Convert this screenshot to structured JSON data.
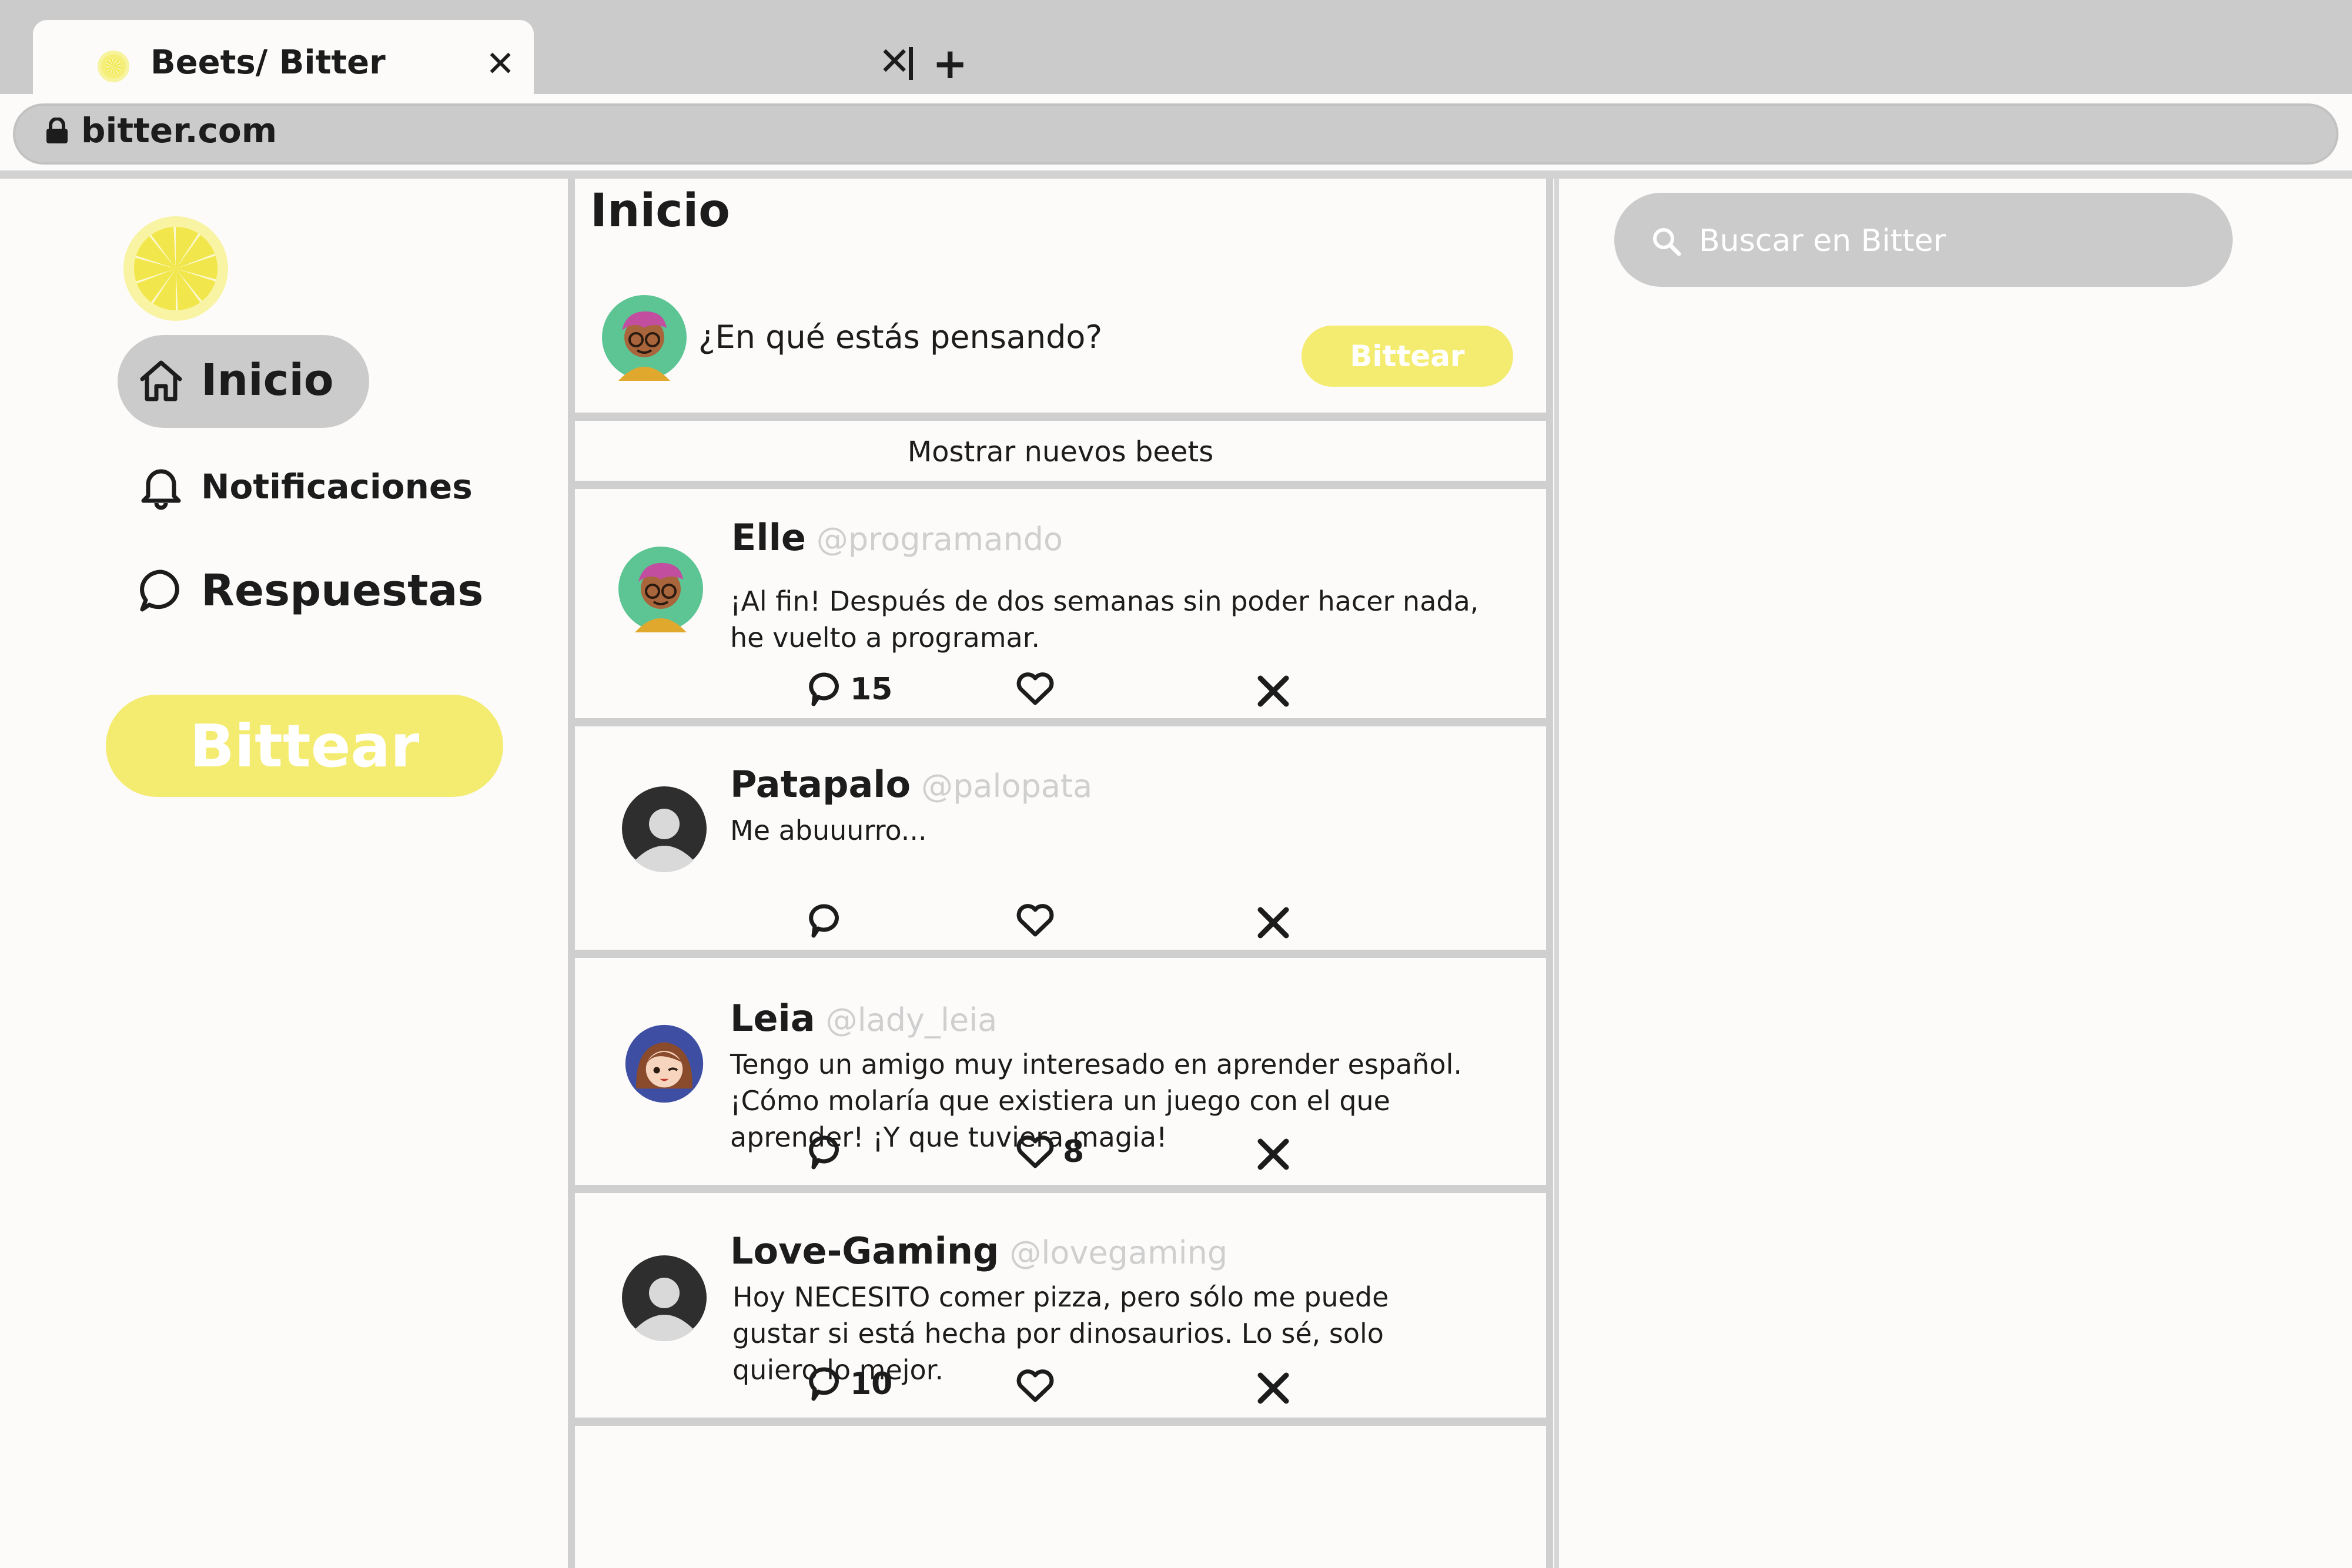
{
  "browser": {
    "tab_title": "Beets/ Bitter",
    "tab_close": "✕",
    "tab_close_2": "✕",
    "new_tab": "+",
    "address": "bitter.com"
  },
  "sidebar": {
    "items": [
      {
        "label": "Inicio",
        "icon": "home-icon"
      },
      {
        "label": "Notificaciones",
        "icon": "bell-icon"
      },
      {
        "label": "Respuestas",
        "icon": "speech-bubble-icon"
      }
    ],
    "bittear_label": "Bittear"
  },
  "timeline": {
    "title": "Inicio",
    "composer": {
      "placeholder": "¿En qué estás pensando?",
      "button_label": "Bittear"
    },
    "show_new_label": "Mostrar nuevos beets",
    "posts": [
      {
        "name": "Elle",
        "handle": "@programando",
        "avatar": "cartoon-avatar-elle",
        "text": "¡Al fin! Después de dos semanas sin poder hacer nada, he vuelto a programar.",
        "replies": "15",
        "likes": ""
      },
      {
        "name": "Patapalo",
        "handle": "@palopata",
        "avatar": "default-avatar",
        "text": "Me abuuurro...",
        "replies": "",
        "likes": ""
      },
      {
        "name": "Leia",
        "handle": "@lady_leia",
        "avatar": "cartoon-avatar-leia",
        "text": "Tengo un amigo muy interesado en aprender español. ¡Cómo molaría que existiera un juego con el que aprender! ¡Y que tuviera magia!",
        "replies": "",
        "likes": "8"
      },
      {
        "name": "Love-Gaming",
        "handle": "@lovegaming",
        "avatar": "default-avatar",
        "text": "Hoy NECESITO comer pizza, pero sólo me puede gustar si está hecha por dinosaurios. Lo sé, solo quiero lo mejor.",
        "replies": "10",
        "likes": ""
      }
    ]
  },
  "search": {
    "placeholder": "Buscar en Bitter"
  },
  "colors": {
    "accent_yellow": "#f4ec71",
    "chrome_gray": "#cbcbcb",
    "background": "#fcfbfa",
    "avatar_green": "#5dc494",
    "avatar_blue": "#3e4fa3"
  }
}
